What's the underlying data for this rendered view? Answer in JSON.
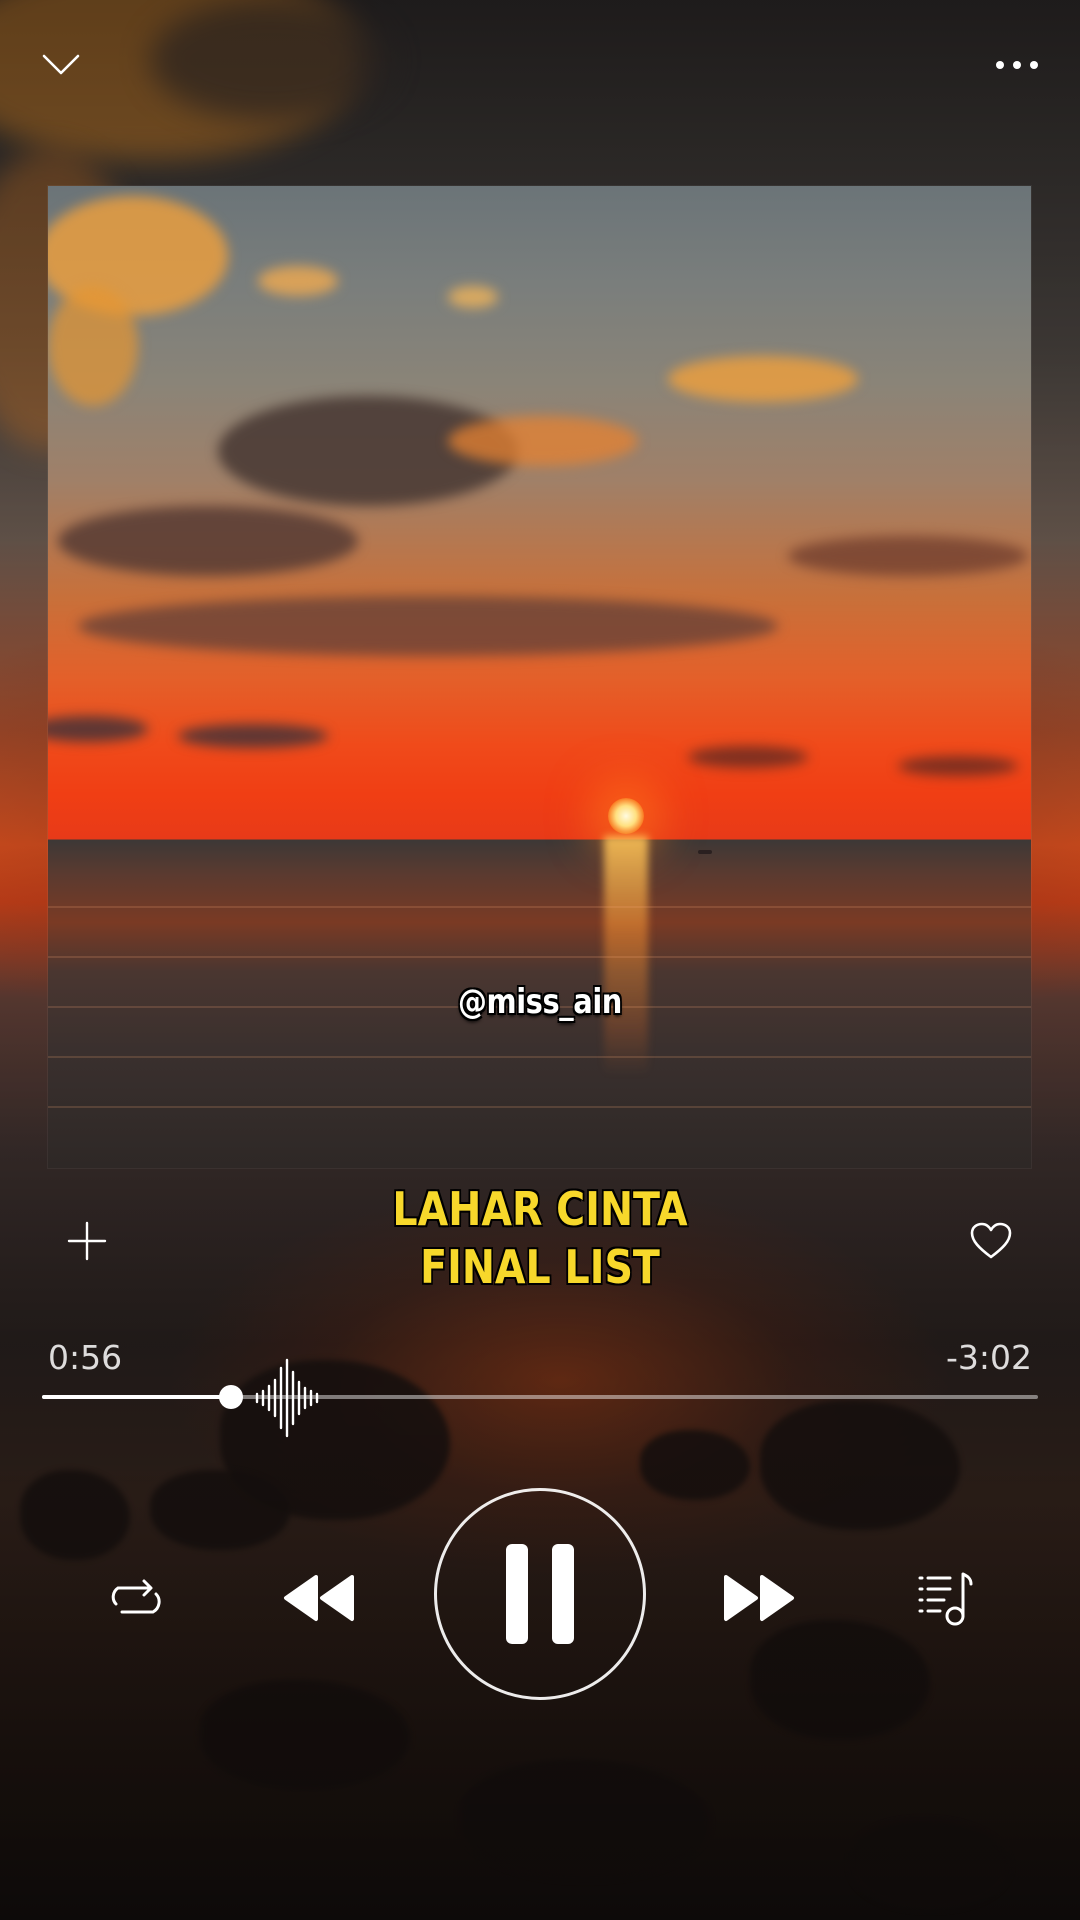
{
  "header": {
    "collapse_icon": "chevron-down-icon",
    "more_icon": "more-horizontal-icon"
  },
  "artwork": {
    "watermark": "@miss_ain"
  },
  "track": {
    "title_line1": "LAHAR CINTA",
    "title_line2": "FINAL LIST",
    "title_color": "#f7d82b"
  },
  "actions": {
    "add_icon": "plus-icon",
    "favorite_icon": "heart-icon"
  },
  "progress": {
    "elapsed": "0:56",
    "remaining": "-3:02",
    "fraction": 0.19
  },
  "controls": {
    "repeat_icon": "repeat-icon",
    "previous_icon": "rewind-icon",
    "play_pause_icon": "pause-icon",
    "next_icon": "fast-forward-icon",
    "queue_icon": "playlist-music-icon"
  }
}
